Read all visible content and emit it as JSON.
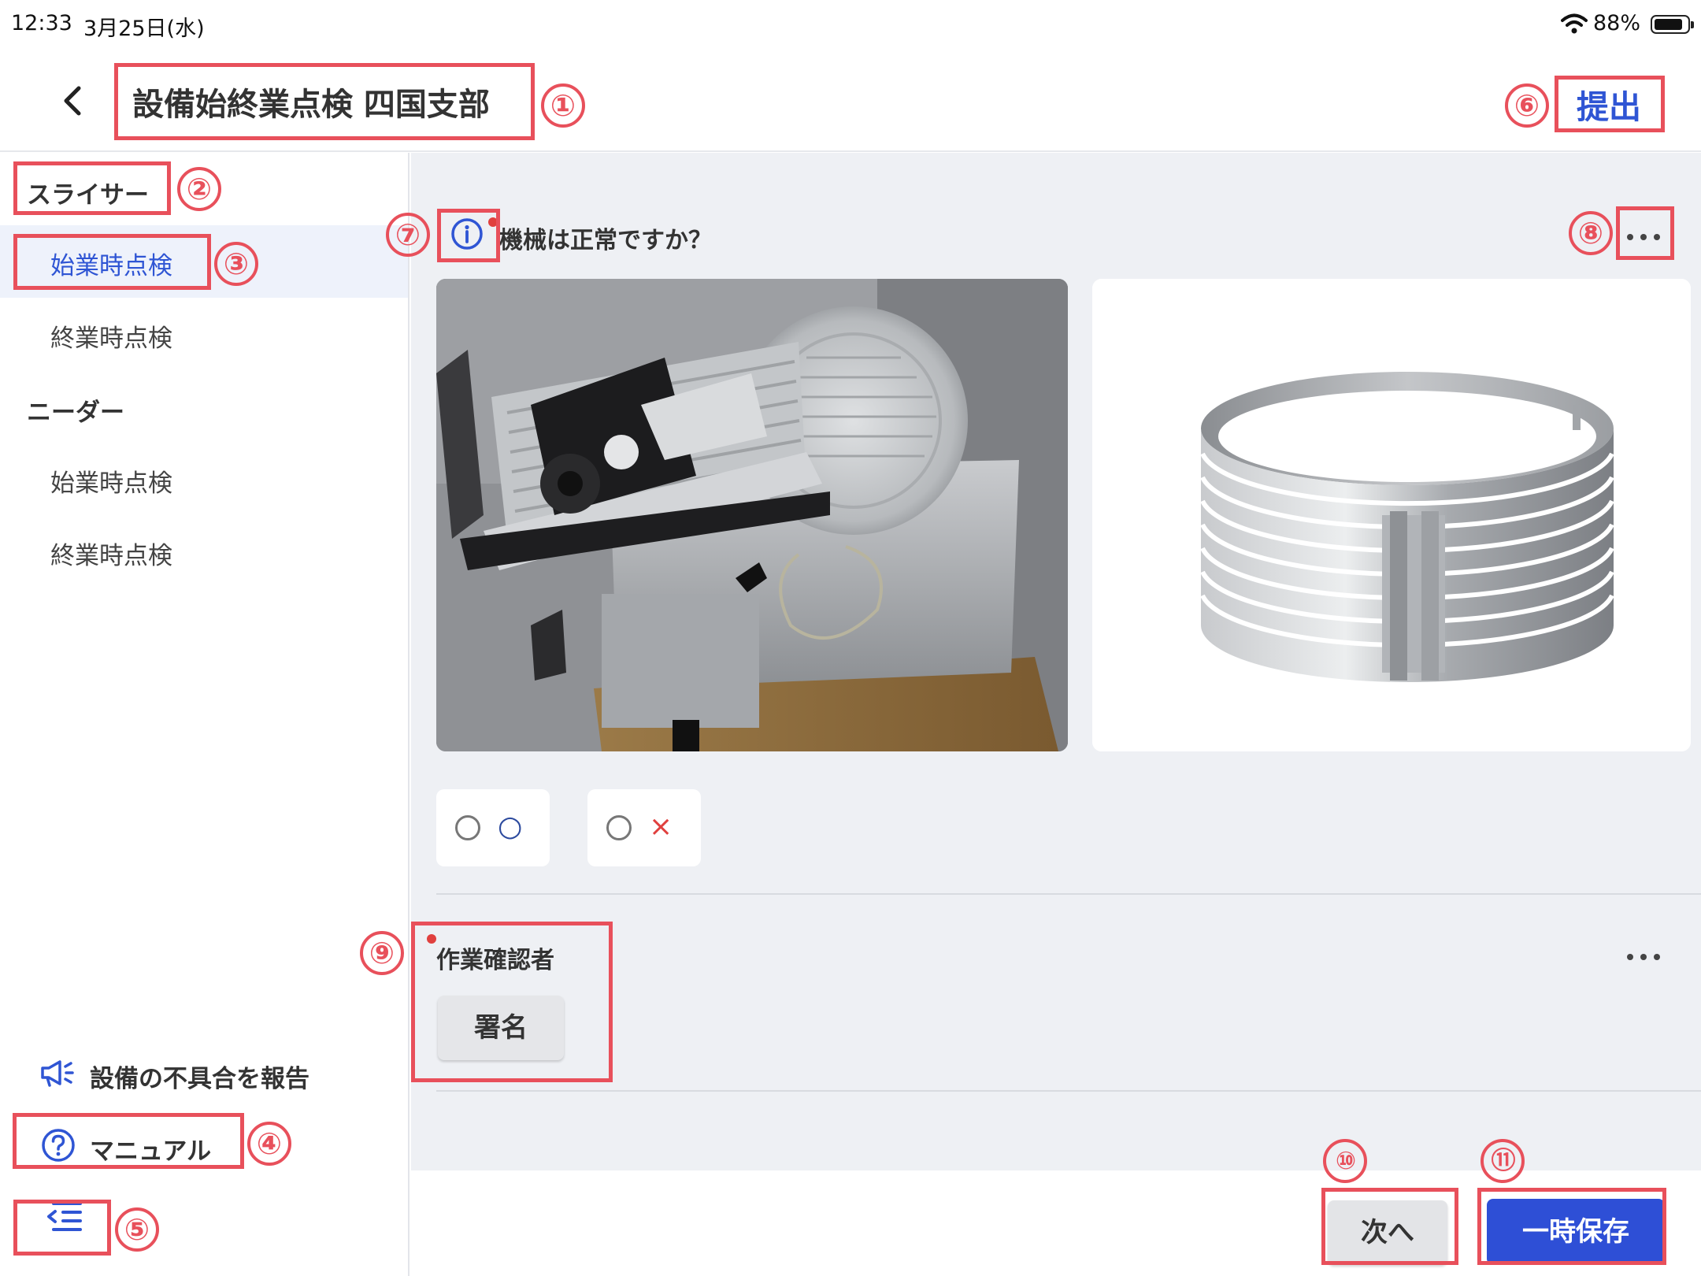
{
  "status_bar": {
    "time": "12:33",
    "date": "3月25日(水)",
    "battery": "88%",
    "battery_level": 0.88
  },
  "header": {
    "title": "設備始終業点検 四国支部",
    "submit_label": "提出"
  },
  "sidebar": {
    "categories": [
      {
        "label": "スライサー",
        "items": [
          {
            "label": "始業時点検",
            "active": true
          },
          {
            "label": "終業時点検",
            "active": false
          }
        ]
      },
      {
        "label": "ニーダー",
        "items": [
          {
            "label": "始業時点検",
            "active": false
          },
          {
            "label": "終業時点検",
            "active": false
          }
        ]
      }
    ],
    "report_label": "設備の不具合を報告",
    "manual_label": "マニュアル"
  },
  "question": {
    "label": "機械は正常ですか？",
    "required": true,
    "options": [
      {
        "label": "○",
        "color": "#2c4a9e"
      },
      {
        "label": "×",
        "color": "#e0403e"
      }
    ]
  },
  "signer": {
    "label": "作業確認者",
    "required": true,
    "sign_label": "署名"
  },
  "footer": {
    "next_label": "次へ",
    "save_label": "一時保存"
  },
  "annotations": [
    "①",
    "②",
    "③",
    "④",
    "⑤",
    "⑥",
    "⑦",
    "⑧",
    "⑨",
    "⑩",
    "⑪"
  ],
  "colors": {
    "accent": "#2f55d4",
    "annotation": "#e8505b",
    "save_button": "#2e4fd6",
    "required_dot": "#e0403e"
  }
}
